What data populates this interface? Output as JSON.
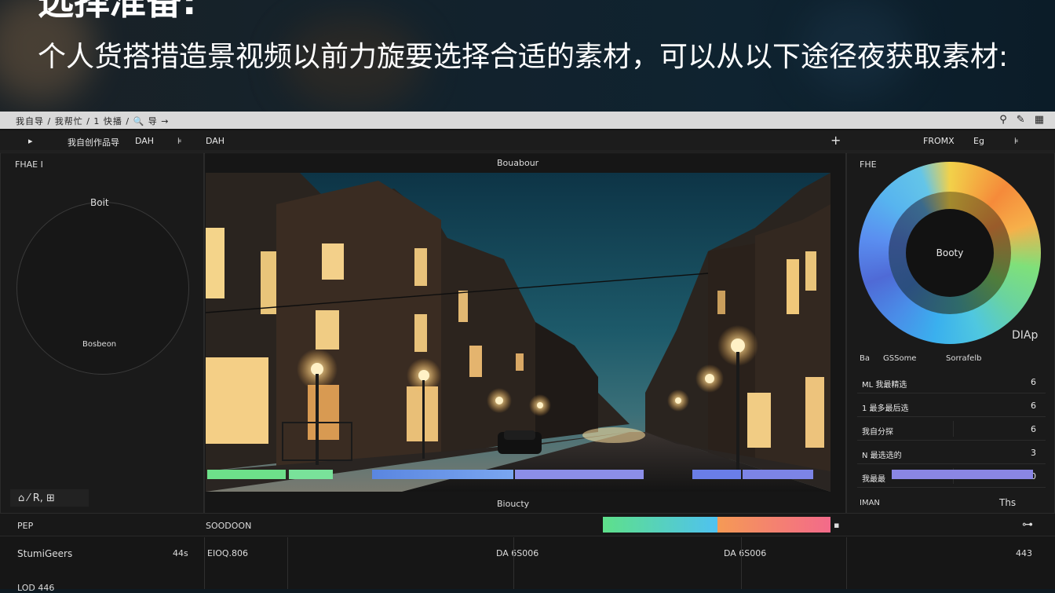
{
  "headline": "选择准备:",
  "subtitle": "个人货搭措造景视频以前力旋要选择合适的素材，可以从以下途径夜获取素材:",
  "titlebar": {
    "menu": "我自导 / 我帮忙 / 1 快播 / 🔍 导 →",
    "right_icons": [
      "search-icon",
      "edit-icon",
      "grid-icon"
    ]
  },
  "toolbar": {
    "play": "▸",
    "name": "我自创作品导",
    "item2": "DAH",
    "item3": "⊧",
    "item4": "DAH",
    "add": "+",
    "right_title": "FROMX",
    "right_b": "Eg",
    "right_c": "⊧"
  },
  "left_panel": {
    "header": "FHAE I",
    "circle_label": "Boit",
    "circle_caption": "Bosbeon",
    "footer": "⌂ ⁄ R, ⊞"
  },
  "viewer": {
    "top_label": "Bouabour",
    "bottom_label": "Bioucty"
  },
  "right_panel": {
    "header": "FHE",
    "wheel_center": "Booty",
    "wheel_label": "DIAp",
    "table_header": {
      "a": "Ba",
      "b": "GSSome",
      "c": "Sorrafelb"
    },
    "rows": [
      {
        "name": "ML 我最精选",
        "value": "6"
      },
      {
        "name": "1 最多最后选",
        "value": "6"
      },
      {
        "name": "我自分探",
        "value": "6"
      },
      {
        "name": "N 最选选的",
        "value": "3"
      },
      {
        "name": "我最最",
        "value": "10"
      }
    ],
    "footer_left": "IMAN",
    "footer_right": "Ths"
  },
  "timeline": {
    "left_header": "PEP",
    "mid_header": "SOODOON",
    "track_label": "StumiGeers",
    "track_count": "44s",
    "time_a": "EIOQ.806",
    "time_b": "DA 6S006",
    "time_c": "DA 6S006",
    "right_count": "443",
    "bottom_label": "LOD 446"
  },
  "colors": {
    "accent_green": "#5ee08a",
    "accent_blue": "#4fc2f0",
    "accent_orange": "#f59a55",
    "accent_pink": "#f36a8a"
  }
}
